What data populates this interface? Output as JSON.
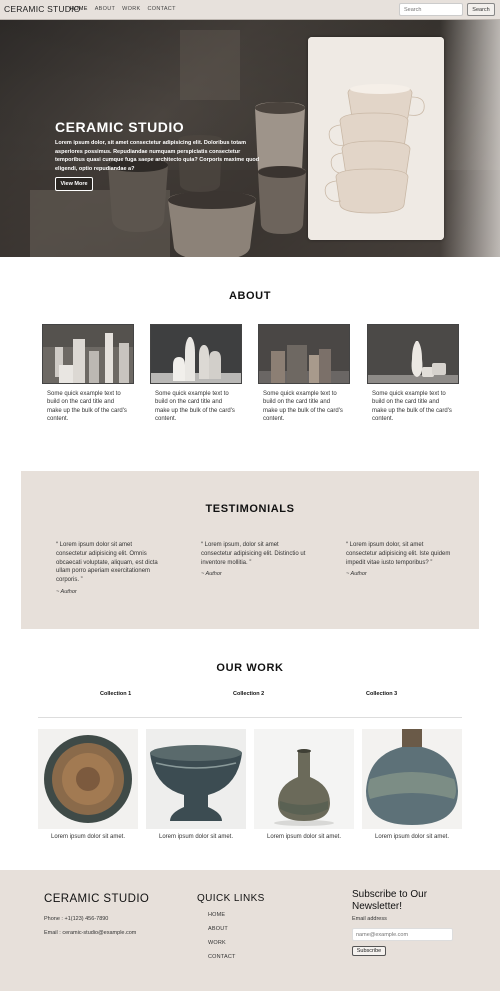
{
  "nav": {
    "brand": "CERAMIC STUDIO",
    "links": [
      "HOME",
      "ABOUT",
      "WORK",
      "CONTACT"
    ],
    "search_placeholder": "Search",
    "search_button": "Search"
  },
  "hero": {
    "title": "CERAMIC STUDIO",
    "text": "Lorem ipsum dolor, sit amet consectetur adipisicing elit. Doloribus totam asperiores possimus. Repudiandae numquam perspiciatis consectetur temporibus quasi cumque fuga saepe architecto quia? Corporis maxime quod eligendi, optio repudiandae a?",
    "button": "View More"
  },
  "about": {
    "title": "ABOUT",
    "cards": [
      {
        "text": "Some quick example text to build on the card title and make up the bulk of the card's content."
      },
      {
        "text": "Some quick example text to build on the card title and make up the bulk of the card's content."
      },
      {
        "text": "Some quick example text to build on the card title and make up the bulk of the card's content."
      },
      {
        "text": "Some quick example text to build on the card title and make up the bulk of the card's content."
      }
    ]
  },
  "testimonials": {
    "title": "TESTIMONIALS",
    "items": [
      {
        "quote": "“ Lorem ipsum dolor sit amet consectetur adipisicing elit. Omnis obcaecati voluptate, aliquam, est dicta ullam porro aperiam exercitationem corporis. ”",
        "author": "~ Author"
      },
      {
        "quote": "“ Lorem ipsum, dolor sit amet consectetur adipisicing elit. Distinctio ut inventore mollitia. ”",
        "author": "~ Author"
      },
      {
        "quote": "“ Lorem ipsum dolor, sit amet consectetur adipisicing elit. Iste quidem impedit vitae iusto temporibus? ”",
        "author": "~ Author"
      }
    ]
  },
  "work": {
    "title": "OUR WORK",
    "collections": [
      "Collection 1",
      "Collection 2",
      "Collection 3"
    ],
    "items": [
      {
        "caption": "Lorem ipsum dolor sit amet."
      },
      {
        "caption": "Lorem ipsum dolor sit amet."
      },
      {
        "caption": "Lorem ipsum dolor sit amet."
      },
      {
        "caption": "Lorem ipsum dolor sit amet."
      }
    ]
  },
  "footer": {
    "brand": "CERAMIC STUDIO",
    "phone": "Phone : +1(123) 456-7890",
    "email": "Email : ceramic-studio@example.com",
    "quick_links_title": "QUICK LINKS",
    "quick_links": [
      "HOME",
      "ABOUT",
      "WORK",
      "CONTACT"
    ],
    "newsletter_title": "Subscribe to Our Newsletter!",
    "email_label": "Email address",
    "email_placeholder": "name@example.com",
    "subscribe_button": "Subscribe"
  }
}
